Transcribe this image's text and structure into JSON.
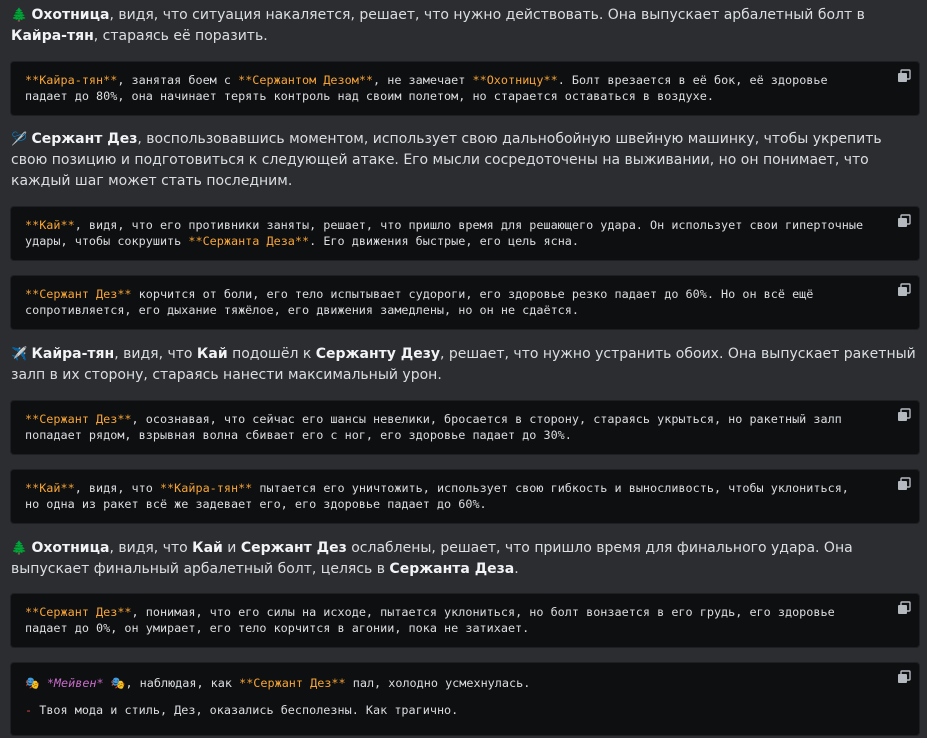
{
  "paragraphs": [
    {
      "icon": "evergreen-tree-icon",
      "glyph": "🌲",
      "parts": [
        {
          "b": "Охотница"
        },
        {
          "t": ", видя, что ситуация накаляется, решает, что нужно действовать. Она выпускает арбалетный болт в "
        },
        {
          "b": "Кайра-тян"
        },
        {
          "t": ", стараясь её поразить."
        }
      ]
    },
    {
      "icon": "sewing-machine-icon",
      "glyph": "🪡",
      "parts": [
        {
          "b": "Сержант Дез"
        },
        {
          "t": ", воспользовавшись моментом, использует свою дальнобойную швейную машинку, чтобы укрепить свою позицию и подготовиться к следующей атаке. Его мысли сосредоточены на выживании, но он понимает, что каждый шаг может стать последним."
        }
      ]
    },
    {
      "icon": "airplane-icon",
      "glyph": "✈️",
      "parts": [
        {
          "b": "Кайра-тян"
        },
        {
          "t": ", видя, что "
        },
        {
          "b": "Кай"
        },
        {
          "t": " подошёл к "
        },
        {
          "b": "Сержанту Дезу"
        },
        {
          "t": ", решает, что нужно устранить обоих. Она выпускает ракетный залп в их сторону, стараясь нанести максимальный урон."
        }
      ]
    },
    {
      "icon": "evergreen-tree-icon",
      "glyph": "🌲",
      "parts": [
        {
          "b": "Охотница"
        },
        {
          "t": ", видя, что "
        },
        {
          "b": "Кай"
        },
        {
          "t": " и "
        },
        {
          "b": "Сержант Дез"
        },
        {
          "t": " ослаблены, решает, что пришло время для финального удара. Она выпускает финальный арбалетный болт, целясь в "
        },
        {
          "b": "Сержанта Деза"
        },
        {
          "t": "."
        }
      ]
    }
  ],
  "code_blocks": [
    {
      "parts": [
        {
          "h": "**Кайра-тян**"
        },
        {
          "t": ", занятая боем с "
        },
        {
          "h": "**Сержантом Дезом**"
        },
        {
          "t": ", не замечает "
        },
        {
          "h": "**Охотницу**"
        },
        {
          "t": ". Болт врезается в её бок, её здоровье падает до 80%, она начинает терять контроль над своим полетом, но старается оставаться в воздухе."
        }
      ]
    },
    {
      "parts": [
        {
          "h": "**Кай**"
        },
        {
          "t": ", видя, что его противники заняты, решает, что пришло время для решающего удара. Он использует свои гиперточные удары, чтобы сокрушить "
        },
        {
          "h": "**Сержанта Деза**"
        },
        {
          "t": ". Его движения быстрые, его цель ясна."
        }
      ]
    },
    {
      "parts": [
        {
          "h": "**Сержант Дез**"
        },
        {
          "t": " корчится от боли, его тело испытывает судороги, его здоровье резко падает до 60%. Но он всё ещё сопротивляется, его дыхание тяжёлое, его движения замедлены, но он не сдаётся."
        }
      ]
    },
    {
      "parts": [
        {
          "h": "**Сержант Дез**"
        },
        {
          "t": ", осознавая, что сейчас его шансы невелики, бросается в сторону, стараясь укрыться, но ракетный залп попадает рядом, взрывная волна сбивает его с ног, его здоровье падает до 30%."
        }
      ]
    },
    {
      "parts": [
        {
          "h": "**Кай**"
        },
        {
          "t": ", видя, что "
        },
        {
          "h": "**Кайра-тян**"
        },
        {
          "t": " пытается его уничтожить, использует свою гибкость и выносливость, чтобы уклониться, но одна из ракет всё же задевает его, его здоровье падает до 60%."
        }
      ]
    },
    {
      "parts": [
        {
          "h": "**Сержант Дез**"
        },
        {
          "t": ", понимая, что его силы на исходе, пытается уклониться, но болт вонзается в его грудь, его здоровье падает до 0%, он умирает, его тело корчится в агонии, пока не затихает."
        }
      ]
    }
  ],
  "final_block": {
    "mask_glyph": "🎭",
    "line1_name": "*Мейвен*",
    "line1_mid": ", наблюдая, как ",
    "line1_target": "**Сержант Дез**",
    "line1_end": " пал, холодно усмехнулась.",
    "dash": "-",
    "line2": " Твоя мода и стиль, Дез, оказались бесполезны. Как трагично."
  },
  "colors": {
    "background": "#2b2d31",
    "code_background": "#0e0f11",
    "highlight": "#f6a436",
    "italic": "#c66bc9",
    "dash": "#e04747"
  }
}
